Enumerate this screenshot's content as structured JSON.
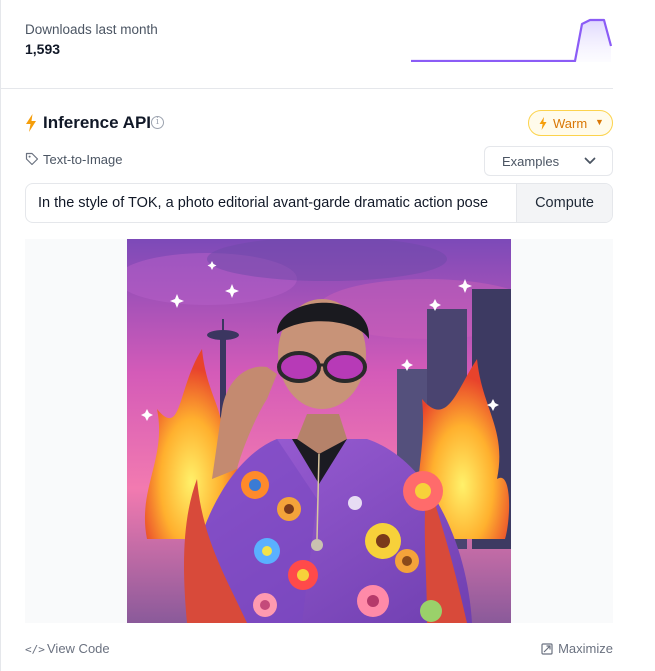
{
  "downloads": {
    "label": "Downloads last month",
    "count": "1,593",
    "sparkline_color": "#8b5cf6"
  },
  "inference": {
    "title": "Inference API",
    "status_badge": "Warm",
    "task": "Text-to-Image",
    "examples_label": "Examples",
    "prompt_value": "In the style of TOK, a photo editorial avant-garde dramatic action pose",
    "compute_label": "Compute",
    "accent_color": "#f59e0b"
  },
  "footer": {
    "view_code_label": "View Code",
    "maximize_label": "Maximize"
  }
}
